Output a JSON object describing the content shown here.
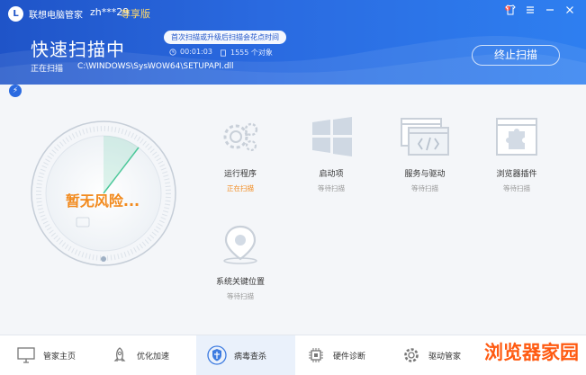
{
  "header": {
    "app_title": "联想电脑管家",
    "username": "zh***29",
    "vip": "尊享版",
    "window_controls": [
      "shirt-icon",
      "menu-icon",
      "minimize-icon",
      "close-icon"
    ],
    "scan_title": "快速扫描中",
    "tooltip": "首次扫描或升级后扫描会花点时间",
    "timer": "00:01:03",
    "object_count": "1555 个对象",
    "scan_label": "正在扫描",
    "scan_path": "C:\\WINDOWS\\SysWOW64\\SETUPAPI.dll",
    "stop_label": "终止扫描"
  },
  "gauge": {
    "risk_text": "暂无风险..."
  },
  "items": [
    {
      "label": "运行程序",
      "status": "正在扫描",
      "icon": "gears-icon"
    },
    {
      "label": "启动项",
      "status": "等待扫描",
      "icon": "windows-icon"
    },
    {
      "label": "服务与驱动",
      "status": "等待扫描",
      "icon": "code-window-icon"
    },
    {
      "label": "浏览器插件",
      "status": "等待扫描",
      "icon": "puzzle-icon"
    },
    {
      "label": "系统关键位置",
      "status": "等待扫描",
      "icon": "location-pin-icon"
    }
  ],
  "nav": [
    {
      "label": "管家主页",
      "icon": "monitor-icon"
    },
    {
      "label": "优化加速",
      "icon": "rocket-icon"
    },
    {
      "label": "病毒查杀",
      "icon": "shield-icon"
    },
    {
      "label": "硬件诊断",
      "icon": "chip-icon"
    },
    {
      "label": "驱动管家",
      "icon": "gear-icon"
    }
  ],
  "watermark": "浏览器家园",
  "colors": {
    "header_start": "#1f54c8",
    "header_end": "#2e7ff0",
    "accent_orange": "#f28a1d",
    "gauge_green": "#4cc89a"
  }
}
